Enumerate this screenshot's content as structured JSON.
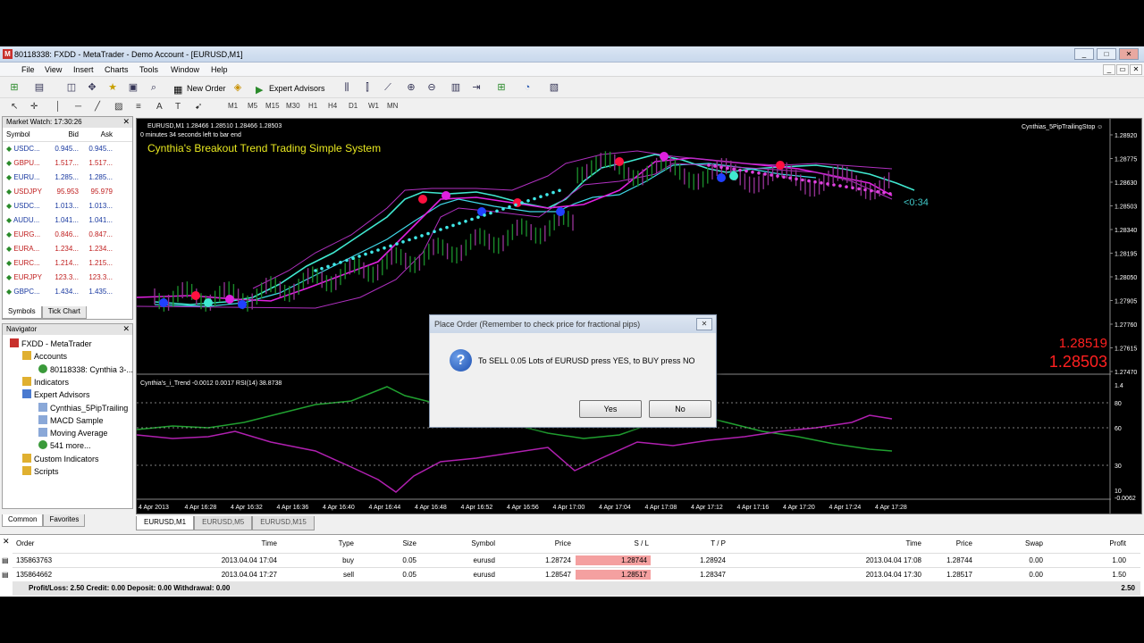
{
  "window": {
    "title": "80118338: FXDD - MetaTrader - Demo Account - [EURUSD,M1]"
  },
  "menu": [
    "File",
    "View",
    "Insert",
    "Charts",
    "Tools",
    "Window",
    "Help"
  ],
  "toolbar": {
    "new_order": "New Order",
    "expert_advisors": "Expert Advisors"
  },
  "timeframes": [
    "M1",
    "M5",
    "M15",
    "M30",
    "H1",
    "H4",
    "D1",
    "W1",
    "MN"
  ],
  "market_watch": {
    "title": "Market Watch: 17:30:26",
    "headers": [
      "Symbol",
      "Bid",
      "Ask"
    ],
    "rows": [
      {
        "symbol": "USDC...",
        "bid": "0.945...",
        "ask": "0.945...",
        "color": "#1a3aa0"
      },
      {
        "symbol": "GBPU...",
        "bid": "1.517...",
        "ask": "1.517...",
        "color": "#c02020"
      },
      {
        "symbol": "EURU...",
        "bid": "1.285...",
        "ask": "1.285...",
        "color": "#1a3aa0"
      },
      {
        "symbol": "USDJPY",
        "bid": "95.953",
        "ask": "95.979",
        "color": "#c02020"
      },
      {
        "symbol": "USDC...",
        "bid": "1.013...",
        "ask": "1.013...",
        "color": "#1a3aa0"
      },
      {
        "symbol": "AUDU...",
        "bid": "1.041...",
        "ask": "1.041...",
        "color": "#1a3aa0"
      },
      {
        "symbol": "EURG...",
        "bid": "0.846...",
        "ask": "0.847...",
        "color": "#c02020"
      },
      {
        "symbol": "EURA...",
        "bid": "1.234...",
        "ask": "1.234...",
        "color": "#c02020"
      },
      {
        "symbol": "EURC...",
        "bid": "1.214...",
        "ask": "1.215...",
        "color": "#c02020"
      },
      {
        "symbol": "EURJPY",
        "bid": "123.3...",
        "ask": "123.3...",
        "color": "#c02020"
      },
      {
        "symbol": "GBPC...",
        "bid": "1.434...",
        "ask": "1.435...",
        "color": "#1a3aa0"
      }
    ],
    "tabs": [
      "Symbols",
      "Tick Chart"
    ]
  },
  "navigator": {
    "title": "Navigator",
    "items": [
      "FXDD - MetaTrader",
      "Accounts",
      "80118338: Cynthia 3-...",
      "Indicators",
      "Expert Advisors",
      "Cynthias_5PipTrailing",
      "MACD Sample",
      "Moving Average",
      "541 more...",
      "Custom Indicators",
      "Scripts"
    ],
    "tabs": [
      "Common",
      "Favorites"
    ]
  },
  "chart": {
    "header": "EURUSD,M1  1.28466 1.28510 1.28466 1.28503",
    "sub": "0 minutes 34 seconds left to bar end",
    "system_title": "Cynthia's Breakout Trend Trading Simple System",
    "ea": "Cynthias_5PipTrailingStop ☺",
    "timer": "<0:34",
    "price1": "1.28519",
    "price2": "1.28503",
    "price_ticks": [
      "1.28920",
      "1.28775",
      "1.28630",
      "1.28503",
      "1.28340",
      "1.28195",
      "1.28050",
      "1.27905",
      "1.27760",
      "1.27615",
      "1.27470"
    ],
    "sub_header": "Cynthia's_i_Trend -0.0012 0.0017  RSI(14) 38.8738",
    "sub_ticks": [
      "1.4",
      "80",
      "60",
      "30",
      "10",
      "-0.0062"
    ],
    "time_ticks": [
      "4 Apr 2013",
      "4 Apr 16:28",
      "4 Apr 16:32",
      "4 Apr 16:36",
      "4 Apr 16:40",
      "4 Apr 16:44",
      "4 Apr 16:48",
      "4 Apr 16:52",
      "4 Apr 16:56",
      "4 Apr 17:00",
      "4 Apr 17:04",
      "4 Apr 17:08",
      "4 Apr 17:12",
      "4 Apr 17:16",
      "4 Apr 17:20",
      "4 Apr 17:24",
      "4 Apr 17:28"
    ]
  },
  "chart_tabs": [
    "EURUSD,M1",
    "EURUSD,M5",
    "EURUSD,M15"
  ],
  "terminal": {
    "headers": [
      "Order",
      "Time",
      "Type",
      "Size",
      "Symbol",
      "Price",
      "S / L",
      "T / P",
      "Time",
      "Price",
      "Swap",
      "Profit"
    ],
    "rows": [
      [
        "135863763",
        "2013.04.04 17:04",
        "buy",
        "0.05",
        "eurusd",
        "1.28724",
        "1.28744",
        "1.28924",
        "2013.04.04 17:08",
        "1.28744",
        "0.00",
        "1.00"
      ],
      [
        "135864662",
        "2013.04.04 17:27",
        "sell",
        "0.05",
        "eurusd",
        "1.28547",
        "1.28517",
        "1.28347",
        "2013.04.04 17:30",
        "1.28517",
        "0.00",
        "1.50"
      ]
    ],
    "summary": "Profit/Loss: 2.50  Credit: 0.00  Deposit: 0.00  Withdrawal: 0.00",
    "total": "2.50"
  },
  "dialog": {
    "title": "Place Order (Remember to check price for fractional pips)",
    "message": "To SELL 0.05 Lots of EURUSD press YES, to BUY press NO",
    "yes": "Yes",
    "no": "No"
  }
}
